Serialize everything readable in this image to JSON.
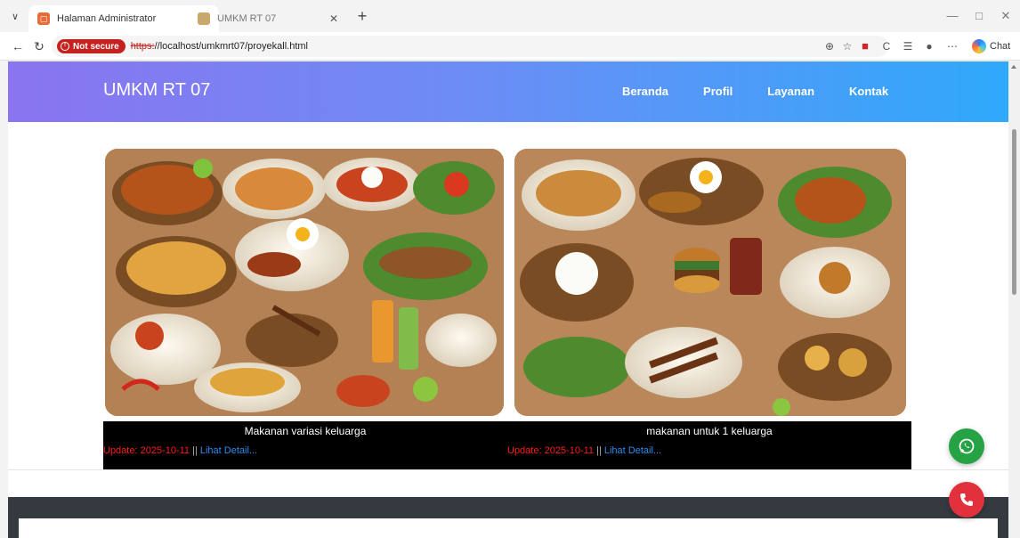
{
  "browser": {
    "tabs": [
      {
        "title": "Halaman Administrator",
        "active": true
      },
      {
        "title": "UMKM RT 07",
        "active": false
      }
    ],
    "security_label": "Not secure",
    "url_scheme": "https:",
    "url_rest": "//localhost/umkmrt07/proyekall.html",
    "chat_label": "Chat"
  },
  "site": {
    "brand": "UMKM RT 07",
    "nav": [
      "Beranda",
      "Profil",
      "Layanan",
      "Kontak"
    ],
    "colors": {
      "header_start": "#8a74ef",
      "header_end": "#2fa9fb",
      "update_red": "#ff1a1a",
      "link_blue": "#2a8cf0",
      "whatsapp": "#25a244",
      "call": "#e0313c"
    }
  },
  "products": [
    {
      "caption": "Makanan variasi keluarga",
      "update": "Update: 2025-10-11",
      "separator": " || ",
      "detail": "Lihat Detail..."
    },
    {
      "caption": "makanan untuk 1 keluarga",
      "update": "Update: 2025-10-11",
      "separator": " || ",
      "detail": "Lihat Detail..."
    }
  ],
  "icons": {
    "whatsapp": "whatsapp-icon",
    "phone": "phone-icon"
  }
}
